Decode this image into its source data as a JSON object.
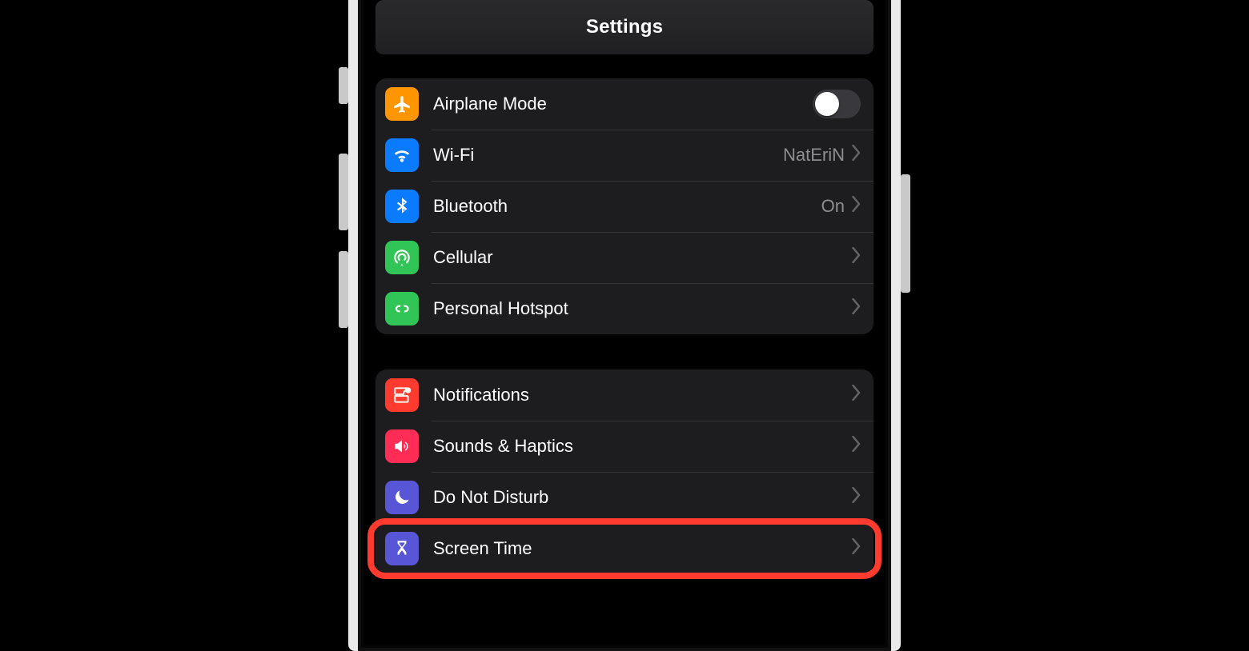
{
  "header": {
    "title": "Settings"
  },
  "colors": {
    "orange": "#ff9500",
    "blue": "#0a7bff",
    "green": "#31c557",
    "red": "#ff3b30",
    "pink": "#ff2d55",
    "indigo": "#5856d6",
    "highlight": "#ff3a2f"
  },
  "groups": [
    {
      "id": "connectivity",
      "rows": [
        {
          "id": "airplane",
          "icon": "airplane-icon",
          "icon_color": "orange",
          "label": "Airplane Mode",
          "accessory": "switch",
          "switch_on": false
        },
        {
          "id": "wifi",
          "icon": "wifi-icon",
          "icon_color": "blue",
          "label": "Wi-Fi",
          "value": "NatEriN",
          "accessory": "disclosure"
        },
        {
          "id": "bluetooth",
          "icon": "bluetooth-icon",
          "icon_color": "blue",
          "label": "Bluetooth",
          "value": "On",
          "accessory": "disclosure"
        },
        {
          "id": "cellular",
          "icon": "cellular-icon",
          "icon_color": "green",
          "label": "Cellular",
          "accessory": "disclosure"
        },
        {
          "id": "hotspot",
          "icon": "hotspot-icon",
          "icon_color": "green",
          "label": "Personal Hotspot",
          "accessory": "disclosure"
        }
      ]
    },
    {
      "id": "general",
      "rows": [
        {
          "id": "notifications",
          "icon": "notifications-icon",
          "icon_color": "red",
          "label": "Notifications",
          "accessory": "disclosure"
        },
        {
          "id": "sounds",
          "icon": "sounds-icon",
          "icon_color": "pink",
          "label": "Sounds & Haptics",
          "accessory": "disclosure"
        },
        {
          "id": "dnd",
          "icon": "moon-icon",
          "icon_color": "indigo",
          "label": "Do Not Disturb",
          "accessory": "disclosure"
        },
        {
          "id": "screentime",
          "icon": "hourglass-icon",
          "icon_color": "indigo",
          "label": "Screen Time",
          "accessory": "disclosure",
          "highlighted": true
        }
      ]
    }
  ]
}
